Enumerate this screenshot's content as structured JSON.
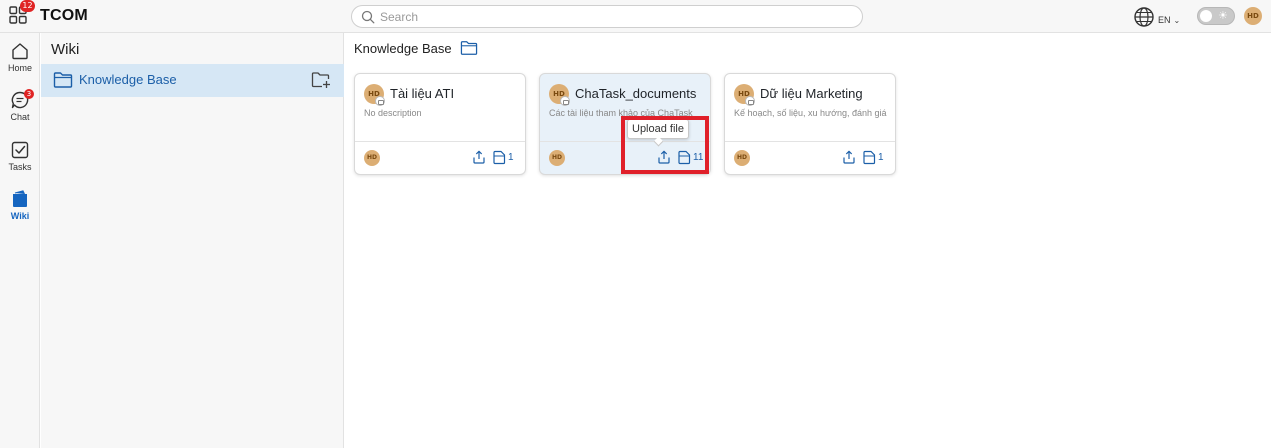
{
  "app": {
    "brand": "TCOM",
    "apps_badge_count": "12",
    "search_placeholder": "Search",
    "language": "EN",
    "user_initials": "HD",
    "colors": {
      "accent": "#1c5fa8",
      "selected_bg": "#d6e7f5",
      "badge": "#e02424",
      "highlight": "#e0202a",
      "avatar": "#dcae74"
    }
  },
  "rail": {
    "items": [
      {
        "label": "Home",
        "icon": "home-icon"
      },
      {
        "label": "Chat",
        "icon": "chat-icon",
        "badge": "3"
      },
      {
        "label": "Tasks",
        "icon": "tasks-icon"
      },
      {
        "label": "Wiki",
        "icon": "wiki-icon",
        "active": true
      }
    ]
  },
  "sidebar": {
    "title": "Wiki",
    "item_label": "Knowledge Base"
  },
  "main": {
    "breadcrumb": "Knowledge Base",
    "cards": [
      {
        "title": "Tài liệu ATI",
        "description": "No description",
        "file_count": "1"
      },
      {
        "title": "ChaTask_documents",
        "description": "Các tài liệu tham khảo của ChaTask",
        "file_count": "11"
      },
      {
        "title": "Dữ liệu Marketing",
        "description": "Kế hoạch, số liệu, xu hướng, đánh giá",
        "file_count": "1"
      }
    ],
    "tooltip": "Upload file"
  }
}
